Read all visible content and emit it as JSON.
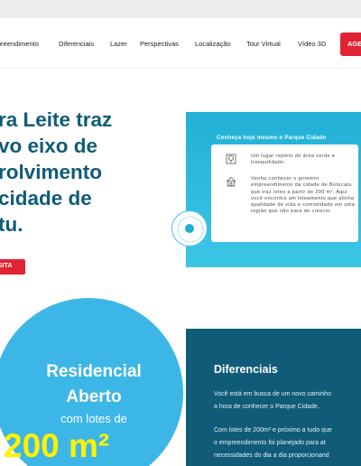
{
  "nav": {
    "items": [
      "preendimento",
      "Diferenciais",
      "Lazer",
      "Perspectivas",
      "Localização",
      "Tour Virtual",
      "Vídeo 3D"
    ],
    "cta": "AGE"
  },
  "hero": {
    "title_lines": [
      "ra Leite traz",
      "vo eixo de",
      "rolvimento",
      "cidade de",
      "tu."
    ],
    "button": "SITA"
  },
  "promo": {
    "heading": "Conheça hoje mesmo o Parque Cidade",
    "point1": "Um lugar repleto de área verde e tranquilidade.",
    "point2": "Venha conhecer o primeiro empreendimento da cidade de Botucatu que traz lotes a partir de 200 m². Aqui você encontra um loteamento que alinha qualidade de vida e comodidade em uma região que não para de crescer.",
    "badge_icon": "parque-cidade-seal"
  },
  "circle": {
    "line1": "Residencial",
    "line2": "Aberto",
    "line3": "com lotes de",
    "line4": "200 m²"
  },
  "diferenciais": {
    "title": "Diferenciais",
    "p1_l1": "Você está em busca de um novo caminho",
    "p1_l2": "a hora de conhecer o Parque Cidade.",
    "p2_l1": "Com lotes de 200m² e próximo a tudo que",
    "p2_l2": "o empreendimento foi planejado para at",
    "p2_l3": "necessidades do dia a dia proporcionand"
  },
  "colors": {
    "brand_blue": "#0f5b78",
    "accent_cyan": "#3cb6e6",
    "cta_red": "#e02433",
    "highlight_yellow": "#fff200"
  }
}
